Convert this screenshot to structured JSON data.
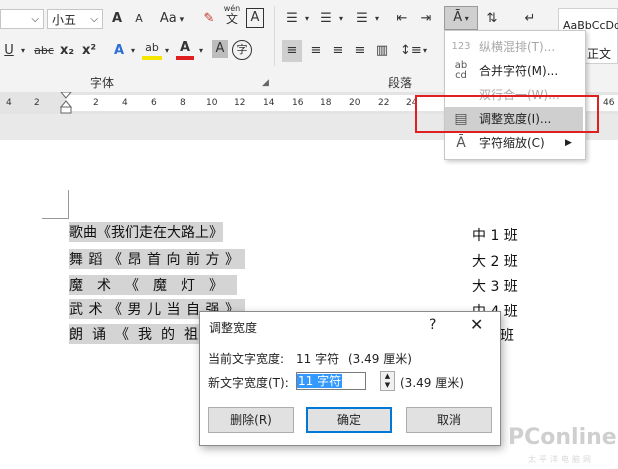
{
  "ribbon": {
    "font_size": "小五",
    "font_group": "字体",
    "para_group": "段落",
    "style_sample": "AaBbCcDd",
    "style_name": "正文",
    "aa_label": "Aa",
    "grow": "A",
    "shrink": "A",
    "wen": "wén",
    "wen_char": "文",
    "char_border": "A",
    "underline": "U",
    "strike": "abc",
    "sub": "x₂",
    "sup": "x²",
    "text_effect": "A",
    "highlight": "ab",
    "font_color": "A",
    "shade": "A",
    "enclose": "字"
  },
  "ruler": {
    "ticks": [
      "4",
      "2",
      "2",
      "4",
      "6",
      "8",
      "10",
      "12",
      "14",
      "16",
      "18",
      "20",
      "22",
      "24",
      "26",
      "46"
    ]
  },
  "menu": {
    "items": [
      {
        "icon": "123",
        "label": "纵横混排(T)...",
        "disabled": true
      },
      {
        "icon": "ab cd",
        "label": "合并字符(M)...",
        "disabled": false
      },
      {
        "icon": "",
        "label": "双行合一(W)...",
        "disabled": true
      },
      {
        "icon": "",
        "label": "调整宽度(I)...",
        "disabled": false
      },
      {
        "icon": "",
        "label": "字符缩放(C)",
        "disabled": false
      }
    ]
  },
  "doc": {
    "lines": [
      "歌曲《我们走在大路上》",
      "舞蹈《昂首向前方》",
      "魔术《魔灯》",
      "武术《男儿当自强》",
      "朗诵《我的祖国》"
    ],
    "right": [
      "中 1 班",
      "大 2 班",
      "大 3 班",
      "中 4 班",
      "班"
    ]
  },
  "dialog": {
    "title": "调整宽度",
    "help": "?",
    "close": "✕",
    "current_label": "当前文字宽度:",
    "current_value": "11 字符",
    "current_cm": "(3.49 厘米)",
    "new_label": "新文字宽度(T):",
    "new_value": "11 字符",
    "new_cm": "(3.49 厘米)",
    "btn_delete": "删除(R)",
    "btn_ok": "确定",
    "btn_cancel": "取消"
  },
  "watermark": {
    "brand": "PConline",
    "sub": "太平洋电脑网"
  }
}
